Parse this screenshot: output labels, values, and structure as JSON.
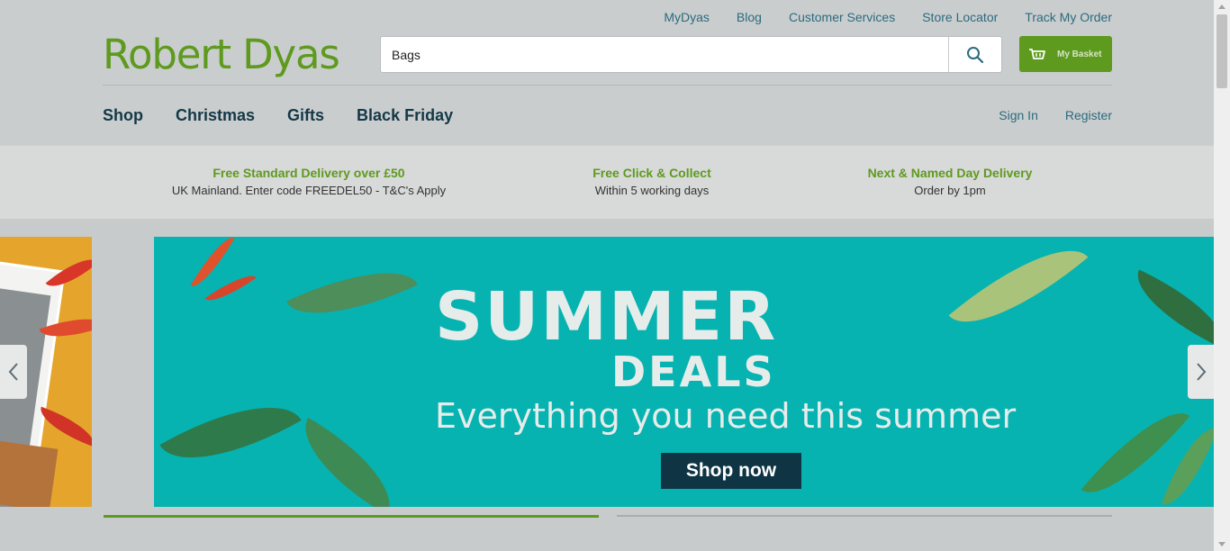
{
  "brand": {
    "logo_text": "Robert Dyas",
    "color": "#5e9a1e"
  },
  "utility_nav": [
    "MyDyas",
    "Blog",
    "Customer Services",
    "Store Locator",
    "Track My Order"
  ],
  "search": {
    "value": "Bags",
    "icon": "search-icon"
  },
  "basket": {
    "label": "My Basket",
    "icon": "basket-icon"
  },
  "main_nav": [
    "Shop",
    "Christmas",
    "Gifts",
    "Black Friday"
  ],
  "account_nav": {
    "sign_in": "Sign In",
    "register": "Register"
  },
  "usps": [
    {
      "title": "Free Standard Delivery over £50",
      "subtitle": "UK Mainland. Enter code FREEDEL50 - T&C's Apply"
    },
    {
      "title": "Free Click & Collect",
      "subtitle": "Within 5 working days"
    },
    {
      "title": "Next & Named Day Delivery",
      "subtitle": "Order by 1pm"
    }
  ],
  "banner": {
    "title": "SUMMER",
    "subtitle": "DEALS",
    "tagline": "Everything you need this summer",
    "cta": "Shop now",
    "background": "#06b3b1"
  },
  "slider_controls": {
    "prev_icon": "chevron-left-icon",
    "next_icon": "chevron-right-icon"
  }
}
